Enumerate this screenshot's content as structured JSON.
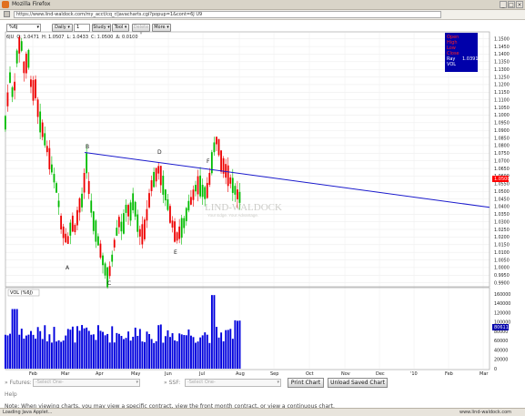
{
  "window": {
    "title": "Mozilla Firefox",
    "url": "https://www.lind-waldock.com/my_acct/cq_r/javacharts.cgi?popup=1&cont=6J U9"
  },
  "toolbar": {
    "symbol": "%6J",
    "period": "Daily",
    "period_count": "1",
    "study": "Study",
    "tool": "Tool",
    "delete": "Delete",
    "more": "More"
  },
  "quote": {
    "symbol": "6JU",
    "open": "O: 1.0471",
    "high": "H: 1.0507",
    "low": "L: 1.0433",
    "close": "C: 1.0500",
    "change": "Δ: 0.0100"
  },
  "legend": {
    "items": [
      "Open",
      "High",
      "Low",
      "Close"
    ],
    "ray_label": "Ray",
    "ray_value": "1.0391",
    "vol_label": "VOL",
    "colors": {
      "text": "#ff2222",
      "bg": "#0000aa"
    }
  },
  "watermark": "LIND-WALDOCK",
  "watermark_sub": "Your Edge. Your Advantage.",
  "annotations": {
    "A": "A",
    "B": "B",
    "C": "C",
    "D": "D",
    "E": "E",
    "F": "F"
  },
  "volume_label": "VOL (%6J)",
  "bottom": {
    "futures_label": "Futures:",
    "futures_select": "-Select One-",
    "ssf_label": "SSF:",
    "ssf_select": "-Select One-",
    "print_button": "Print Chart",
    "unload_button": "Unload Saved Chart",
    "help": "Help",
    "note": "Note: When viewing charts, you may view a specific contract, view the front month contract, or view a continuous chart."
  },
  "status": {
    "left": "Loading Java Applet...",
    "right": "www.lind-waldock.com"
  },
  "chart_data": {
    "type": "candlestick",
    "price_ticks": [
      "1.1500",
      "1.1450",
      "1.1400",
      "1.1350",
      "1.1300",
      "1.1250",
      "1.1200",
      "1.1150",
      "1.1100",
      "1.1050",
      "1.1000",
      "1.0950",
      "1.0900",
      "1.0850",
      "1.0800",
      "1.0750",
      "1.0700",
      "1.0650",
      "1.0600",
      "1.0550",
      "1.0500",
      "1.0450",
      "1.0400",
      "1.0350",
      "1.0300",
      "1.0250",
      "1.0200",
      "1.0150",
      "1.0100",
      "1.0050",
      "1.0000",
      "0.9950",
      "0.9900"
    ],
    "price_range": [
      0.988,
      1.154
    ],
    "last_price": "1.0500",
    "ray_price": "1.0391",
    "volume_ticks": [
      "160000",
      "140000",
      "120000",
      "100000",
      "80000",
      "60000",
      "40000",
      "20000",
      "0"
    ],
    "volume_range": [
      0,
      170000
    ],
    "last_volume": "80611",
    "month_labels": [
      "Feb",
      "Mar",
      "Apr",
      "May",
      "Jun",
      "Jul",
      "Aug",
      "Sep",
      "Oct",
      "Nov",
      "Dec",
      "'10",
      "Feb",
      "Mar"
    ],
    "periodicity": "Daily",
    "trendline": {
      "from": {
        "date": "Mar 10",
        "price": 1.0755
      },
      "to": {
        "date": "Mar '10",
        "price": 1.0395
      }
    },
    "ohlc": [],
    "volume": []
  },
  "colors": {
    "up": "#00bb00",
    "down": "#ee0000",
    "trend": "#1a1acc",
    "volume": "#0000dd"
  }
}
